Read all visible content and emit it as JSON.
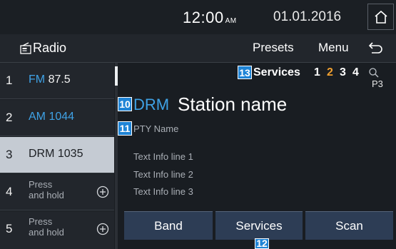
{
  "status": {
    "time": "12:00",
    "ampm": "AM",
    "date": "01.01.2016"
  },
  "header": {
    "title": "Radio",
    "presets_label": "Presets",
    "menu_label": "Menu"
  },
  "presets": [
    {
      "num": "1",
      "band": "FM",
      "freq": "87.5"
    },
    {
      "num": "2",
      "band": "AM",
      "freq": "1044"
    },
    {
      "num": "3",
      "label": "DRM 1035",
      "active": true
    },
    {
      "num": "4",
      "hold_line1": "Press",
      "hold_line2": "and hold"
    },
    {
      "num": "5",
      "hold_line1": "Press",
      "hold_line2": "and hold"
    }
  ],
  "main": {
    "services_label": "Services",
    "service_numbers": [
      "1",
      "2",
      "3",
      "4"
    ],
    "selected_service": "2",
    "pty_index": "P3",
    "band": "DRM",
    "station_name": "Station name",
    "pty_name": "PTY Name",
    "info_lines": [
      "Text Info line 1",
      "Text Info line 2",
      "Text Info line 3"
    ]
  },
  "callouts": {
    "services": "13",
    "drm": "10",
    "pty": "11",
    "softkey": "12"
  },
  "softkeys": {
    "band": "Band",
    "services": "Services",
    "scan": "Scan"
  },
  "colors": {
    "band_text": "#3fa2e6",
    "selected_service": "#f0a030",
    "callout_badge": "#1f84d6",
    "softkey_bg": "#2d3d55"
  },
  "icons": {
    "home": "home-icon",
    "back": "back-arrow-icon",
    "radio": "radio-icon",
    "add": "plus-circle-icon",
    "search": "search-icon"
  }
}
